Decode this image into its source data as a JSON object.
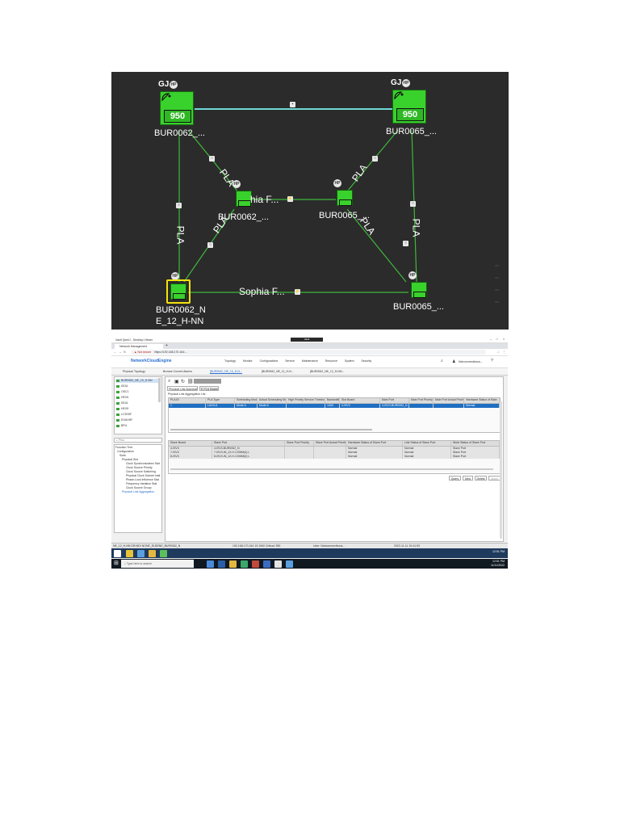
{
  "topology": {
    "nodes": {
      "bur0062_top": {
        "label": "BUR0062_...",
        "badge_gj": "GJ",
        "badge_hp": "HP",
        "model": "950"
      },
      "bur0065_top": {
        "label": "BUR0065_...",
        "badge_gj": "GJ",
        "badge_hp": "HP",
        "model": "950"
      },
      "bur0062_mid": {
        "label": "BUR0062_...",
        "badge_hp": "HP",
        "partial_label": "hia F..."
      },
      "bur0065_mid": {
        "label": "BUR0065_...",
        "badge_hp": "HP"
      },
      "bur0062_bottom": {
        "label_line1": "BUR0062_N",
        "label_line2": "E_12_H-NN",
        "badge_hp": "HP"
      },
      "bur0065_bottom": {
        "label": "BUR0065_...",
        "badge_hp": "HP"
      }
    },
    "link_labels": {
      "pla_left": "PLA",
      "pla_diag1": "PLA",
      "pla_diag2": "PLA",
      "pla_right_top": "PLA",
      "pla_right_mid": "PLA",
      "pla_right": "PLA",
      "sophia_bottom": "Sophia F..."
    },
    "colors": {
      "background": "#2b2b2b",
      "node": "#39d12c",
      "link": "#3fb83a",
      "top_link": "#6fd6d6",
      "selection": "#f4e30c"
    }
  },
  "app": {
    "window_title": "Vault Qwt4J - Desktop Viewer",
    "browser_tab": "Network Management",
    "address": "https://192.168.170.164:...",
    "security_warning": "Not secure",
    "brand": "NetworkCloudEngine",
    "nav": [
      "Topology",
      "Monitor",
      "Configurations",
      "Service",
      "Maintenance",
      "Resource",
      "System",
      "Security"
    ],
    "user": "Nxtconnnectbous...",
    "page_tabs": [
      "Physical Topology",
      "Browse Current Alarms",
      "[BUR0062_NE_10_H-N...",
      "[BUR0062_NE_11_H-N...",
      "[BUR0062_NE_12_H-NN..."
    ],
    "left_tree_top": {
      "selected": "BUR0062_NE_10_H-NN",
      "items": [
        "ISOA",
        "OSC1",
        "HEX5",
        "ISOA",
        "HEX5",
        "LC3SSF",
        "EOAHSF",
        "BPU"
      ]
    },
    "search_placeholder": "Plus",
    "left_tree_bottom": [
      "Function Tree",
      "Configuration",
      "Slots",
      "Physical Slot",
      "Clock Synchronization Stat",
      "Clock Source Priority",
      "Clock Source Switching",
      "Physical Clock Subnet Instt",
      "Phase-Lock Influence Stat",
      "Frequency Variation Stat",
      "Clock Source Group",
      "Physical Link Aggregation"
    ],
    "content_tabs": [
      "Physical Link Aggregation",
      "E-PLA Master"
    ],
    "table1": {
      "caption": "Physical Link Aggregation List",
      "headers": [
        "PLA ID",
        "PLA Type",
        "Scheduling Mode",
        "Actual Scheduling Mode",
        "High Priority Service Threshold",
        "Bandwidth",
        "Slot Board",
        "Main Port",
        "Main Port Priority",
        "Main Port Actual Priority",
        "Hardware Status of Main"
      ],
      "rows": [
        [
          "1",
          "LAG/LA",
          "Mode A",
          "Mode A",
          "",
          "1000",
          "4-ISV3",
          "4-ISV3-BUR0062_N",
          "",
          "",
          "Normal"
        ]
      ]
    },
    "table2": {
      "headers": [
        "Slave Board",
        "Slave Port",
        "Slave Port Priority",
        "Slave Port Actual Priority",
        "Hardware Status of Slave Port",
        "Link Status of Slave Port",
        "Work Status of Slave Port"
      ],
      "rows": [
        [
          "4-ISV3",
          "4-ISV3-BUR0062_N",
          "",
          "",
          "Normal",
          "Normal",
          "Slave Port"
        ],
        [
          "7-ISV3",
          "7-ISV3-IN_12-H-COMM(4) L",
          "",
          "",
          "Normal",
          "Normal",
          "Slave Port"
        ],
        [
          "8-ISV3",
          "8-ISV3-IN_12-H-COMM(4) L",
          "",
          "",
          "Normal",
          "Normal",
          "Slave Port"
        ]
      ]
    },
    "buttons": [
      "Query",
      "New",
      "Delete",
      "Apply"
    ],
    "status_left": "NE_12_H-NN DR:MDI NONE_ELBENE_BUR0062_N",
    "status_mid": "192.168.170.164 10:1060 Critical: 350",
    "status_right": "User: Nxtconnnectbous...",
    "status_time": "2022-11-11 10:41:53",
    "taskbar_search": "Type here to search",
    "clock_time": "12:51 PM",
    "clock_date": "11/11/2022",
    "vault_caption": "Vault"
  }
}
